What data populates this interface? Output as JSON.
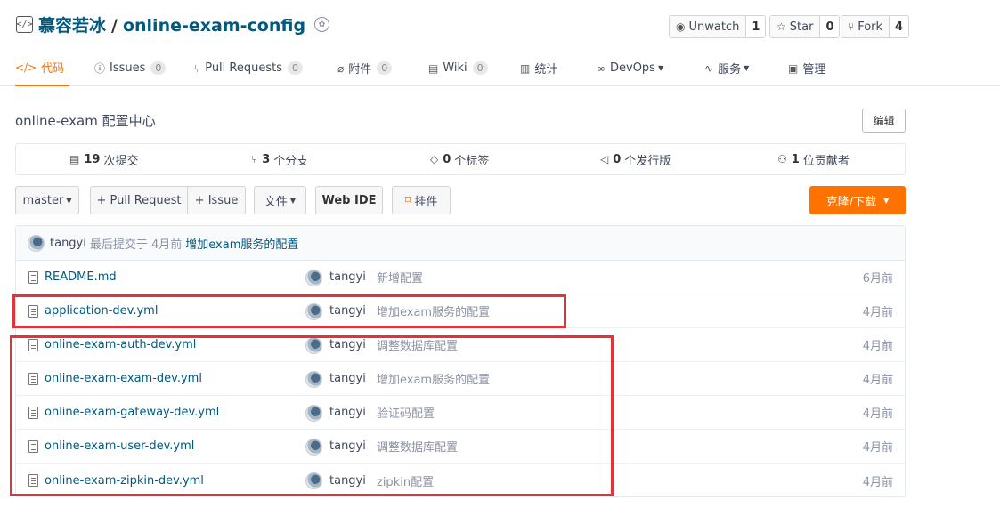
{
  "repo": {
    "owner": "慕容若冰",
    "separator": "/",
    "name": "online-exam-config"
  },
  "actions": {
    "unwatch": {
      "label": "Unwatch",
      "count": "1"
    },
    "star": {
      "label": "Star",
      "count": "0"
    },
    "fork": {
      "label": "Fork",
      "count": "4"
    }
  },
  "nav": {
    "code": "代码",
    "issues": {
      "label": "Issues",
      "count": "0"
    },
    "pulls": {
      "label": "Pull Requests",
      "count": "0"
    },
    "attachments": {
      "label": "附件",
      "count": "0"
    },
    "wiki": {
      "label": "Wiki",
      "count": "0"
    },
    "stats": "统计",
    "devops": "DevOps",
    "services": "服务",
    "manage": "管理"
  },
  "description": "online-exam 配置中心",
  "edit_label": "编辑",
  "stats": {
    "commits": {
      "count": "19",
      "label": "次提交"
    },
    "branches": {
      "count": "3",
      "label": "个分支"
    },
    "tags": {
      "count": "0",
      "label": "个标签"
    },
    "releases": {
      "count": "0",
      "label": "个发行版"
    },
    "contributors": {
      "count": "1",
      "label": "位贡献者"
    }
  },
  "toolbar": {
    "branch": "master",
    "pull_request": "+ Pull Request",
    "issue": "+ Issue",
    "files": "文件",
    "web_ide": "Web IDE",
    "pendant": "挂件",
    "clone": "克隆/下载"
  },
  "latest_commit": {
    "author": "tangyi",
    "meta": "最后提交于 4月前",
    "message": "增加exam服务的配置"
  },
  "files": [
    {
      "name": "README.md",
      "author": "tangyi",
      "message": "新增配置",
      "time": "6月前"
    },
    {
      "name": "application-dev.yml",
      "author": "tangyi",
      "message": "增加exam服务的配置",
      "time": "4月前"
    },
    {
      "name": "online-exam-auth-dev.yml",
      "author": "tangyi",
      "message": "调整数据库配置",
      "time": "4月前"
    },
    {
      "name": "online-exam-exam-dev.yml",
      "author": "tangyi",
      "message": "增加exam服务的配置",
      "time": "4月前"
    },
    {
      "name": "online-exam-gateway-dev.yml",
      "author": "tangyi",
      "message": "验证码配置",
      "time": "4月前"
    },
    {
      "name": "online-exam-user-dev.yml",
      "author": "tangyi",
      "message": "调整数据库配置",
      "time": "4月前"
    },
    {
      "name": "online-exam-zipkin-dev.yml",
      "author": "tangyi",
      "message": "zipkin配置",
      "time": "4月前"
    }
  ]
}
